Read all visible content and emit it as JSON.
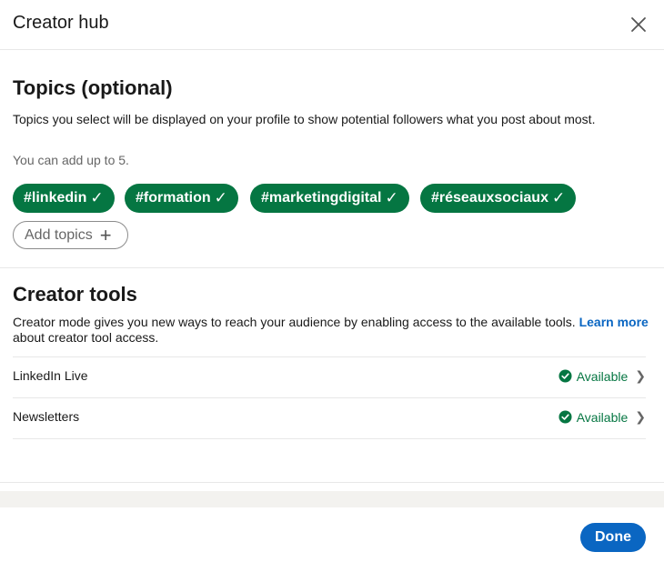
{
  "header": {
    "title": "Creator hub",
    "close_icon": "close-icon"
  },
  "topics": {
    "title": "Topics (optional)",
    "description": "Topics you select will be displayed on your profile to show potential followers what you post about most.",
    "limit_note": "You can add up to 5.",
    "selected": [
      {
        "label": "#linkedin",
        "check": "✓"
      },
      {
        "label": "#formation",
        "check": "✓"
      },
      {
        "label": "#marketingdigital",
        "check": "✓"
      },
      {
        "label": "#réseauxsociaux",
        "check": "✓"
      }
    ],
    "add_label": "Add topics",
    "add_icon": "+"
  },
  "creator_tools": {
    "title": "Creator tools",
    "description": "Creator mode gives you new ways to reach your audience by enabling access to the available tools. ",
    "learn_more": "Learn more",
    "description_tail": " about creator tool access.",
    "tools": [
      {
        "name": "LinkedIn Live",
        "status": "Available",
        "chevron": "❯"
      },
      {
        "name": "Newsletters",
        "status": "Available",
        "chevron": "❯"
      }
    ]
  },
  "footer": {
    "done_label": "Done"
  },
  "colors": {
    "accent_blue": "#0a66c2",
    "chip_green": "#057642",
    "status_green": "#057642"
  }
}
